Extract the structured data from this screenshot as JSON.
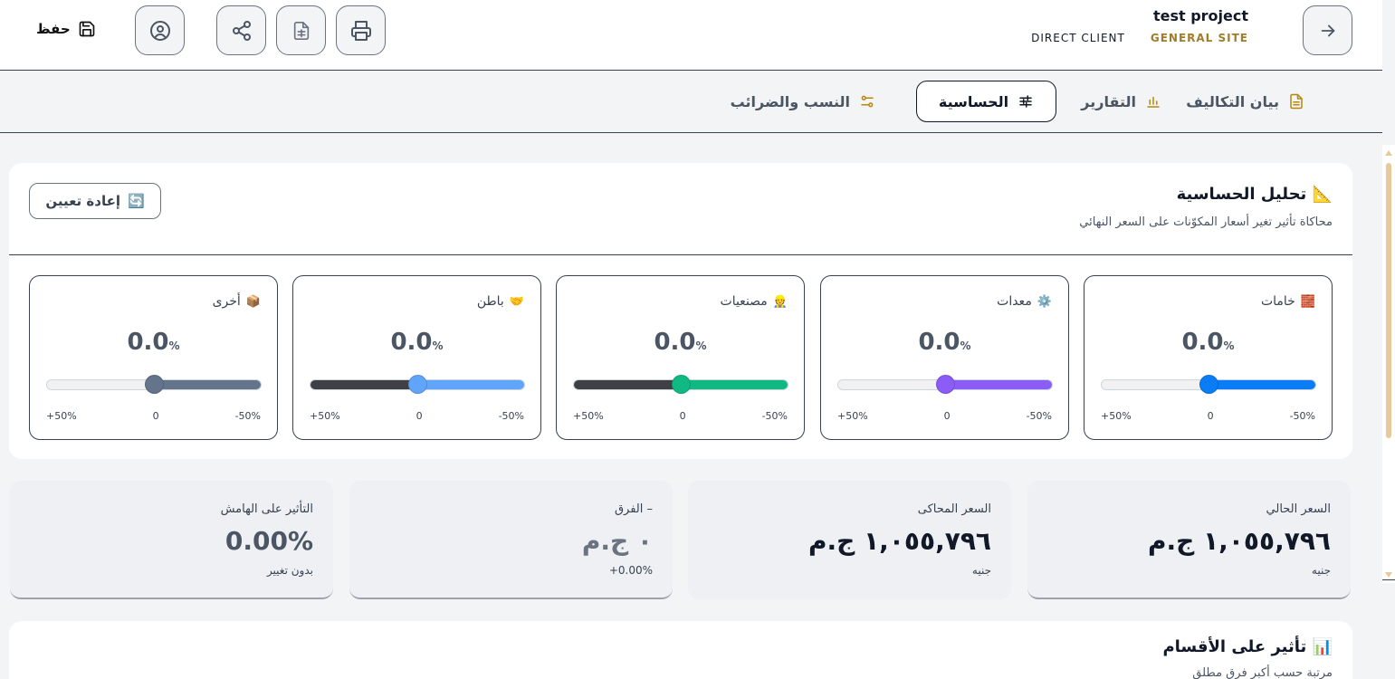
{
  "header": {
    "project_name": "test project",
    "client": "DIRECT CLIENT",
    "site": "GENERAL SITE",
    "save_label": "حفظ"
  },
  "tabs": [
    {
      "label": "بيان التكاليف",
      "icon": "document-icon"
    },
    {
      "label": "التقارير",
      "icon": "bar-chart-icon"
    },
    {
      "label": "الحساسية",
      "icon": "sliders-icon",
      "active": true
    },
    {
      "label": "النسب والضرائب",
      "icon": "settings-icon"
    }
  ],
  "sensitivity": {
    "emoji": "📐",
    "title": "تحليل الحساسية",
    "subtitle": "محاكاة تأثير تغير أسعار المكوّنات على السعر النهائي",
    "reset_emoji": "🔄",
    "reset_label": "إعادة تعيين",
    "tick_min": "-50%",
    "tick_mid": "0",
    "tick_max": "+50%",
    "percent_sign": "%",
    "sliders": [
      {
        "emoji": "🧱",
        "label": "خامات",
        "value": "0.0",
        "color": "#0a7cf5"
      },
      {
        "emoji": "⚙️",
        "label": "معدات",
        "value": "0.0",
        "color": "#8b5cf6"
      },
      {
        "emoji": "👷",
        "label": "مصنعيات",
        "value": "0.0",
        "color": "#10b981"
      },
      {
        "emoji": "🤝",
        "label": "باطن",
        "value": "0.0",
        "color": "#60a5fa"
      },
      {
        "emoji": "📦",
        "label": "أخرى",
        "value": "0.0",
        "color": "#64748b"
      }
    ]
  },
  "stats": [
    {
      "label": "السعر الحالي",
      "value": "١,٠٥٥,٧٩٦ ج.م",
      "sub": "جنيه"
    },
    {
      "label": "السعر المحاكى",
      "value": "١,٠٥٥,٧٩٦ ج.م",
      "sub": "جنيه"
    },
    {
      "label": "– الفرق",
      "value": "٠ ج.م",
      "sub": "+0.00%"
    },
    {
      "label": "التأثير على الهامش",
      "value": "0.00%",
      "sub": "بدون تغيير"
    }
  ],
  "sections": {
    "emoji": "📊",
    "title": "تأثير على الأقسام",
    "subtitle": "مرتبة حسب أكبر فرق مطلق"
  }
}
